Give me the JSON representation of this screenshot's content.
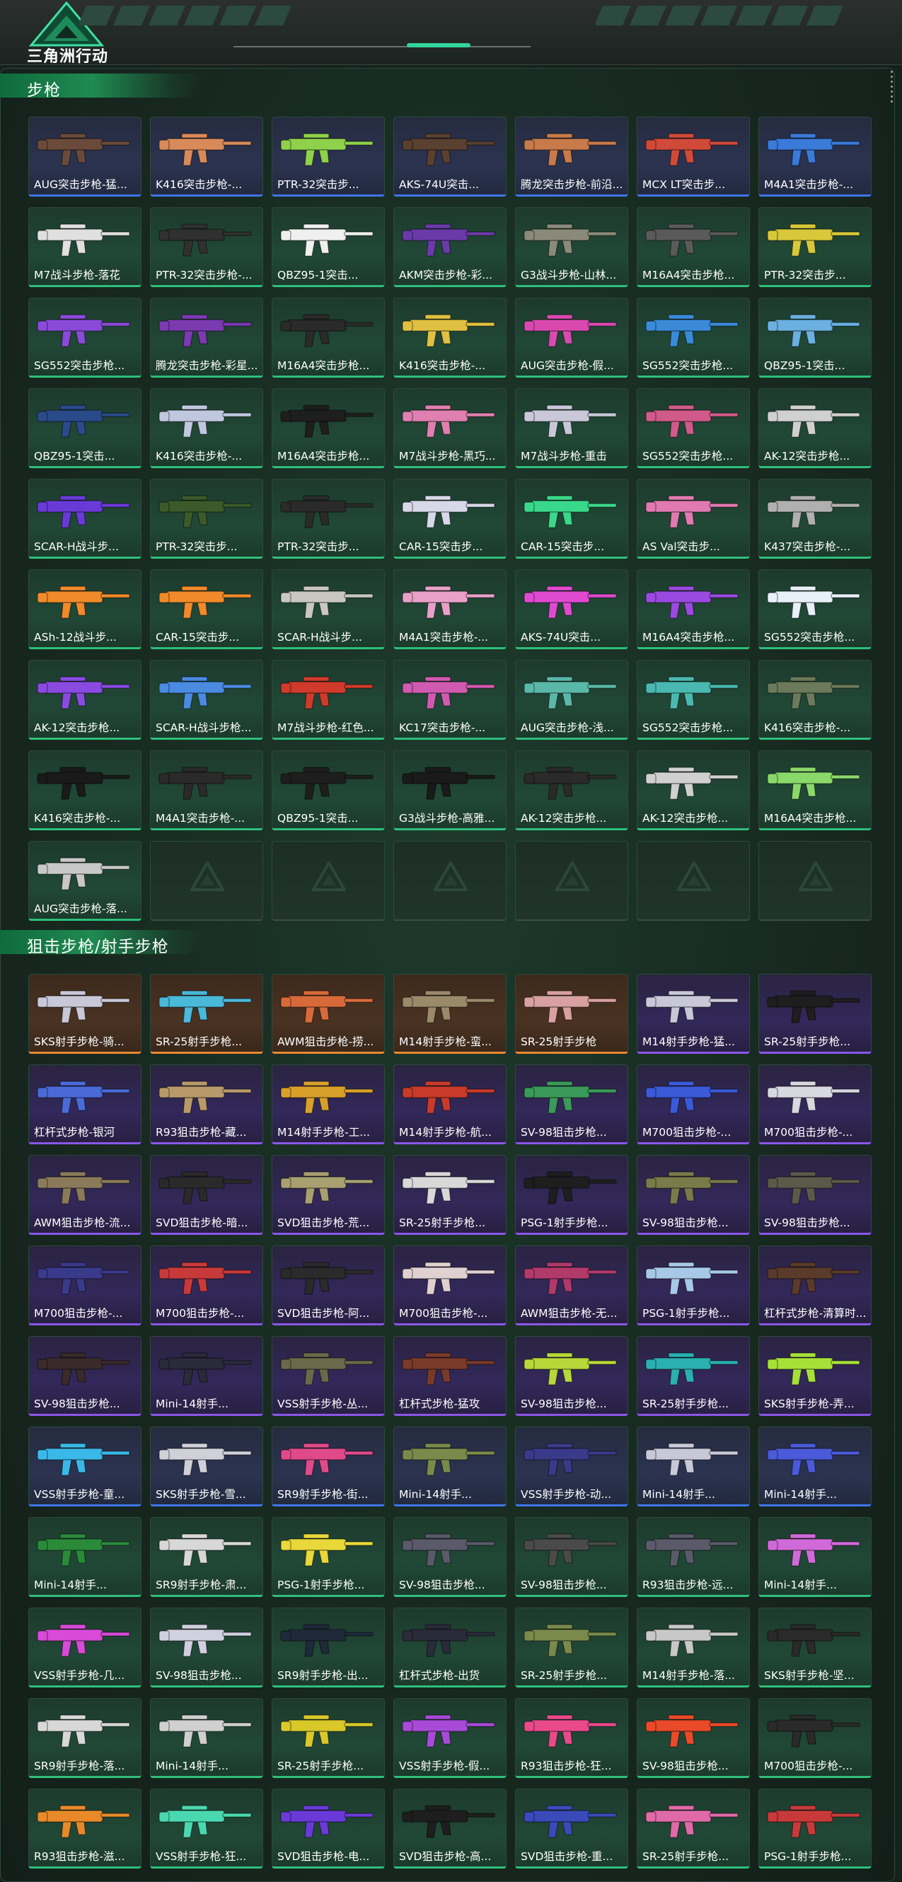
{
  "header": {
    "logo_text": "三角洲行动",
    "accent": "#34d39a"
  },
  "sections": [
    {
      "title": "步枪",
      "items": [
        {
          "label": "AUG突击步枪-猛...",
          "rarity": "blue",
          "color": "#6a4a3a"
        },
        {
          "label": "K416突击步枪-...",
          "rarity": "blue",
          "color": "#d98a5a"
        },
        {
          "label": "PTR-32突击步...",
          "rarity": "blue",
          "color": "#8fd14a"
        },
        {
          "label": "AKS-74U突击...",
          "rarity": "blue",
          "color": "#5a4030"
        },
        {
          "label": "腾龙突击步枪-前沿...",
          "rarity": "blue",
          "color": "#c87a4a"
        },
        {
          "label": "MCX LT突击步...",
          "rarity": "blue",
          "color": "#d04a3a"
        },
        {
          "label": "M4A1突击步枪-...",
          "rarity": "blue",
          "color": "#3a7ad8"
        },
        {
          "label": "M7战斗步枪-落花",
          "rarity": "green",
          "color": "#e0e0e0"
        },
        {
          "label": "PTR-32突击步枪-...",
          "rarity": "green",
          "color": "#303030"
        },
        {
          "label": "QBZ95-1突击...",
          "rarity": "green",
          "color": "#f0f0f0"
        },
        {
          "label": "AKM突击步枪-彩...",
          "rarity": "green",
          "color": "#6a3aa8"
        },
        {
          "label": "G3战斗步枪-山林...",
          "rarity": "green",
          "color": "#8a8a7a"
        },
        {
          "label": "M16A4突击步枪...",
          "rarity": "green",
          "color": "#5a5a5a"
        },
        {
          "label": "PTR-32突击步...",
          "rarity": "green",
          "color": "#d8c83a"
        },
        {
          "label": "SG552突击步枪...",
          "rarity": "green",
          "color": "#8a4ad8"
        },
        {
          "label": "腾龙突击步枪-彩星...",
          "rarity": "green",
          "color": "#7a3ab0"
        },
        {
          "label": "M16A4突击步枪...",
          "rarity": "green",
          "color": "#2a2a2a"
        },
        {
          "label": "K416突击步枪-...",
          "rarity": "green",
          "color": "#e0c040"
        },
        {
          "label": "AUG突击步枪-假...",
          "rarity": "green",
          "color": "#d84ab0"
        },
        {
          "label": "SG552突击步枪...",
          "rarity": "green",
          "color": "#3a8ad8"
        },
        {
          "label": "QBZ95-1突击...",
          "rarity": "green",
          "color": "#6ab0e0"
        },
        {
          "label": "QBZ95-1突击...",
          "rarity": "green",
          "color": "#2a4a8a"
        },
        {
          "label": "K416突击步枪-...",
          "rarity": "green",
          "color": "#c0c8e0"
        },
        {
          "label": "M16A4突击步枪...",
          "rarity": "green",
          "color": "#1e1e1e"
        },
        {
          "label": "M7战斗步枪-黑巧...",
          "rarity": "green",
          "color": "#e080b0"
        },
        {
          "label": "M7战斗步枪-重击",
          "rarity": "green",
          "color": "#c8c8d8"
        },
        {
          "label": "SG552突击步枪...",
          "rarity": "green",
          "color": "#d05a8a"
        },
        {
          "label": "AK-12突击步枪...",
          "rarity": "green",
          "color": "#d0d0d0"
        },
        {
          "label": "SCAR-H战斗步...",
          "rarity": "green",
          "color": "#6a3ad8"
        },
        {
          "label": "PTR-32突击步...",
          "rarity": "green",
          "color": "#3a5a2a"
        },
        {
          "label": "PTR-32突击步...",
          "rarity": "green",
          "color": "#2a2a2a"
        },
        {
          "label": "CAR-15突击步...",
          "rarity": "green",
          "color": "#d8d8e8"
        },
        {
          "label": "CAR-15突击步...",
          "rarity": "green",
          "color": "#3ad88a"
        },
        {
          "label": "AS Val突击步...",
          "rarity": "green",
          "color": "#e07ab0"
        },
        {
          "label": "K437突击步枪-...",
          "rarity": "green",
          "color": "#b0b0b0"
        },
        {
          "label": "ASh-12战斗步...",
          "rarity": "green",
          "color": "#f08a2a"
        },
        {
          "label": "CAR-15突击步...",
          "rarity": "green",
          "color": "#f08a2a"
        },
        {
          "label": "SCAR-H战斗步...",
          "rarity": "green",
          "color": "#c8c8c0"
        },
        {
          "label": "M4A1突击步枪-...",
          "rarity": "green",
          "color": "#e8a0c8"
        },
        {
          "label": "AKS-74U突击...",
          "rarity": "green",
          "color": "#e04ad0"
        },
        {
          "label": "M16A4突击步枪...",
          "rarity": "green",
          "color": "#9a4ae0"
        },
        {
          "label": "SG552突击步枪...",
          "rarity": "green",
          "color": "#e8f0f8"
        },
        {
          "label": "AK-12突击步枪...",
          "rarity": "green",
          "color": "#8a4ae0"
        },
        {
          "label": "SCAR-H战斗步枪...",
          "rarity": "green",
          "color": "#4a8ae0"
        },
        {
          "label": "M7战斗步枪-红色...",
          "rarity": "green",
          "color": "#d03a2a"
        },
        {
          "label": "KC17突击步枪-...",
          "rarity": "green",
          "color": "#d05ab0"
        },
        {
          "label": "AUG突击步枪-浅...",
          "rarity": "green",
          "color": "#5ab8a8"
        },
        {
          "label": "SG552突击步枪...",
          "rarity": "green",
          "color": "#4ab8b0"
        },
        {
          "label": "K416突击步枪-...",
          "rarity": "green",
          "color": "#6a7a5a"
        },
        {
          "label": "K416突击步枪-...",
          "rarity": "green",
          "color": "#1a1a1a"
        },
        {
          "label": "M4A1突击步枪-...",
          "rarity": "green",
          "color": "#2a2a2a"
        },
        {
          "label": "QBZ95-1突击...",
          "rarity": "green",
          "color": "#1e1e1e"
        },
        {
          "label": "G3战斗步枪-高雅...",
          "rarity": "green",
          "color": "#1a1a1a"
        },
        {
          "label": "AK-12突击步枪...",
          "rarity": "green",
          "color": "#2a2a2a"
        },
        {
          "label": "AK-12突击步枪...",
          "rarity": "green",
          "color": "#d0d0d0"
        },
        {
          "label": "M16A4突击步枪...",
          "rarity": "green",
          "color": "#8ad86a"
        },
        {
          "label": "AUG突击步枪-落...",
          "rarity": "green",
          "color": "#c8c8c8"
        },
        {
          "label": "",
          "rarity": "empty",
          "color": ""
        },
        {
          "label": "",
          "rarity": "empty",
          "color": ""
        },
        {
          "label": "",
          "rarity": "empty",
          "color": ""
        },
        {
          "label": "",
          "rarity": "empty",
          "color": ""
        },
        {
          "label": "",
          "rarity": "empty",
          "color": ""
        },
        {
          "label": "",
          "rarity": "empty",
          "color": ""
        }
      ]
    },
    {
      "title": "狙击步枪/射手步枪",
      "items": [
        {
          "label": "SKS射手步枪-骑...",
          "rarity": "orange",
          "color": "#c8c8d8"
        },
        {
          "label": "SR-25射手步枪...",
          "rarity": "orange",
          "color": "#4ab8d8"
        },
        {
          "label": "AWM狙击步枪-捞...",
          "rarity": "orange",
          "color": "#d86a3a"
        },
        {
          "label": "M14射手步枪-蛮...",
          "rarity": "orange",
          "color": "#9a8a6a"
        },
        {
          "label": "SR-25射手步枪",
          "rarity": "orange",
          "color": "#d8a0a0"
        },
        {
          "label": "M14射手步枪-猛...",
          "rarity": "purple",
          "color": "#c8c8d8"
        },
        {
          "label": "SR-25射手步枪...",
          "rarity": "purple",
          "color": "#1e1e1e"
        },
        {
          "label": "杠杆式步枪-银河",
          "rarity": "purple",
          "color": "#4a6ad8"
        },
        {
          "label": "R93狙击步枪-藏...",
          "rarity": "purple",
          "color": "#b89a6a"
        },
        {
          "label": "M14射手步枪-工...",
          "rarity": "purple",
          "color": "#d8a02a"
        },
        {
          "label": "M14射手步枪-航...",
          "rarity": "purple",
          "color": "#c83a2a"
        },
        {
          "label": "SV-98狙击步枪...",
          "rarity": "purple",
          "color": "#3a9a5a"
        },
        {
          "label": "M700狙击步枪-...",
          "rarity": "purple",
          "color": "#3a5ad8"
        },
        {
          "label": "M700狙击步枪-...",
          "rarity": "purple",
          "color": "#d8d8e0"
        },
        {
          "label": "AWM狙击步枪-流...",
          "rarity": "purple",
          "color": "#8a7a5a"
        },
        {
          "label": "SVD狙击步枪-暗...",
          "rarity": "purple",
          "color": "#2a2a2a"
        },
        {
          "label": "SVD狙击步枪-荒...",
          "rarity": "purple",
          "color": "#a8a070"
        },
        {
          "label": "SR-25射手步枪...",
          "rarity": "purple",
          "color": "#d8d8d8"
        },
        {
          "label": "PSG-1射手步枪...",
          "rarity": "purple",
          "color": "#1e1e1e"
        },
        {
          "label": "SV-98狙击步枪...",
          "rarity": "purple",
          "color": "#7a7a4a"
        },
        {
          "label": "SV-98狙击步枪...",
          "rarity": "purple",
          "color": "#5a5a4a"
        },
        {
          "label": "M700狙击步枪-...",
          "rarity": "purple",
          "color": "#3a3a8a"
        },
        {
          "label": "M700狙击步枪-...",
          "rarity": "purple",
          "color": "#c83a3a"
        },
        {
          "label": "SVD狙击步枪-阿...",
          "rarity": "purple",
          "color": "#2a2a2a"
        },
        {
          "label": "M700狙击步枪-...",
          "rarity": "purple",
          "color": "#e0d0d0"
        },
        {
          "label": "AWM狙击步枪-无...",
          "rarity": "purple",
          "color": "#b03a6a"
        },
        {
          "label": "PSG-1射手步枪...",
          "rarity": "purple",
          "color": "#a8c8e8"
        },
        {
          "label": "杠杆式步枪-清算时...",
          "rarity": "purple",
          "color": "#5a3a2a"
        },
        {
          "label": "SV-98狙击步枪...",
          "rarity": "purple",
          "color": "#3a2a2a"
        },
        {
          "label": "Mini-14射手...",
          "rarity": "purple",
          "color": "#2a2a3a"
        },
        {
          "label": "VSS射手步枪-丛...",
          "rarity": "purple",
          "color": "#6a6a4a"
        },
        {
          "label": "杠杆式步枪-猛攻",
          "rarity": "purple",
          "color": "#7a3a2a"
        },
        {
          "label": "SV-98狙击步枪...",
          "rarity": "purple",
          "color": "#b8d83a"
        },
        {
          "label": "SR-25射手步枪...",
          "rarity": "purple",
          "color": "#2ab0b0"
        },
        {
          "label": "SKS射手步枪-弄...",
          "rarity": "purple",
          "color": "#a8e03a"
        },
        {
          "label": "VSS射手步枪-童...",
          "rarity": "blue",
          "color": "#3ab8e8"
        },
        {
          "label": "SKS射手步枪-雪...",
          "rarity": "blue",
          "color": "#d0d0d8"
        },
        {
          "label": "SR9射手步枪-街...",
          "rarity": "blue",
          "color": "#e04a8a"
        },
        {
          "label": "Mini-14射手...",
          "rarity": "blue",
          "color": "#7a8a4a"
        },
        {
          "label": "VSS射手步枪-动...",
          "rarity": "blue",
          "color": "#3a3a8a"
        },
        {
          "label": "Mini-14射手...",
          "rarity": "blue",
          "color": "#c8c8d8"
        },
        {
          "label": "Mini-14射手...",
          "rarity": "blue",
          "color": "#4a5ad8"
        },
        {
          "label": "Mini-14射手...",
          "rarity": "green",
          "color": "#2a8a3a"
        },
        {
          "label": "SR9射手步枪-肃...",
          "rarity": "green",
          "color": "#d8d8d8"
        },
        {
          "label": "PSG-1射手步枪...",
          "rarity": "green",
          "color": "#e8d83a"
        },
        {
          "label": "SV-98狙击步枪...",
          "rarity": "green",
          "color": "#5a5a6a"
        },
        {
          "label": "SV-98狙击步枪...",
          "rarity": "green",
          "color": "#4a4a4a"
        },
        {
          "label": "R93狙击步枪-远...",
          "rarity": "green",
          "color": "#5a5a6a"
        },
        {
          "label": "Mini-14射手...",
          "rarity": "green",
          "color": "#d06ad8"
        },
        {
          "label": "VSS射手步枪-几...",
          "rarity": "green",
          "color": "#d84ad8"
        },
        {
          "label": "SV-98狙击步枪...",
          "rarity": "green",
          "color": "#d0d0e0"
        },
        {
          "label": "SR9射手步枪-出...",
          "rarity": "green",
          "color": "#1e2a3a"
        },
        {
          "label": "杠杆式步枪-出货",
          "rarity": "green",
          "color": "#2a2a3a"
        },
        {
          "label": "SR-25射手步枪...",
          "rarity": "green",
          "color": "#7a8a4a"
        },
        {
          "label": "M14射手步枪-落...",
          "rarity": "green",
          "color": "#c8c8c8"
        },
        {
          "label": "SKS射手步枪-坚...",
          "rarity": "green",
          "color": "#2a2a2a"
        },
        {
          "label": "SR9射手步枪-落...",
          "rarity": "green",
          "color": "#d8d8d8"
        },
        {
          "label": "Mini-14射手...",
          "rarity": "green",
          "color": "#d0d0d0"
        },
        {
          "label": "SR-25射手步枪...",
          "rarity": "green",
          "color": "#d8c82a"
        },
        {
          "label": "VSS射手步枪-假...",
          "rarity": "green",
          "color": "#a84ad8"
        },
        {
          "label": "R93狙击步枪-狂...",
          "rarity": "green",
          "color": "#e84a8a"
        },
        {
          "label": "SV-98狙击步枪...",
          "rarity": "green",
          "color": "#e84a2a"
        },
        {
          "label": "M700狙击步枪-...",
          "rarity": "green",
          "color": "#2a2a2a"
        },
        {
          "label": "R93狙击步枪-滋...",
          "rarity": "green",
          "color": "#e88a2a"
        },
        {
          "label": "VSS射手步枪-狂...",
          "rarity": "green",
          "color": "#4ad8b0"
        },
        {
          "label": "SVD狙击步枪-电...",
          "rarity": "green",
          "color": "#6a3ad8"
        },
        {
          "label": "SVD狙击步枪-高...",
          "rarity": "green",
          "color": "#1e1e1e"
        },
        {
          "label": "SVD狙击步枪-重...",
          "rarity": "green",
          "color": "#3a4ab8"
        },
        {
          "label": "SR-25射手步枪...",
          "rarity": "green",
          "color": "#e06aa8"
        },
        {
          "label": "PSG-1射手步枪...",
          "rarity": "green",
          "color": "#c83a3a"
        }
      ]
    }
  ]
}
